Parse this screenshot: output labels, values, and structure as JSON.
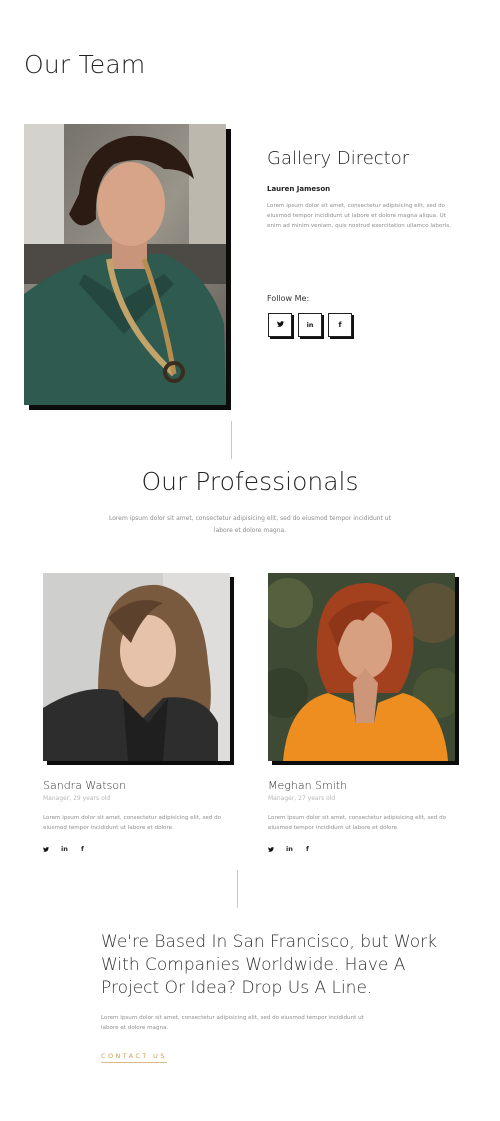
{
  "page": {
    "title": "Our Team"
  },
  "director": {
    "role": "Gallery Director",
    "name": "Lauren Jameson",
    "description": "Lorem ipsum dolor sit amet, consectetur adipisicing elit, sed do eiusmod tempor incididunt ut labore et dolore magna aliqua. Ut enim ad minim veniam, quis nostrud exercitation ullamco laboris.",
    "follow_label": "Follow Me:",
    "social": [
      {
        "icon": "twitter-icon",
        "glyph": "𝕥"
      },
      {
        "icon": "linkedin-icon",
        "glyph": "in"
      },
      {
        "icon": "facebook-icon",
        "glyph": "f"
      }
    ]
  },
  "professionals": {
    "title": "Our Professionals",
    "intro": "Lorem ipsum dolor sit amet, consectetur adipisicing elit, sed do eiusmod tempor incididunt ut labore et dolore magna.",
    "members": [
      {
        "name": "Sandra Watson",
        "subtitle": "Manager, 29 years old",
        "description": "Lorem ipsum dolor sit amet, consectetur adipisicing elit, sed do eiusmod tempor incididunt ut labore et dolore."
      },
      {
        "name": "Meghan Smith",
        "subtitle": "Manager, 27 years old",
        "description": "Lorem ipsum dolor sit amet, consectetur adipisicing elit, sed do eiusmod tempor incididunt ut labore et dolore."
      }
    ],
    "social_glyphs": {
      "twitter": "🐦",
      "linkedin": "in",
      "facebook": "f"
    }
  },
  "cta": {
    "title": "We're Based In San Francisco, but Work With Companies Worldwide. Have A Project Or Idea? Drop Us A Line.",
    "text": "Lorem ipsum dolor sit amet, consectetur adipisicing elit, sed do eiusmod tempor incididunt ut labore et dolore magna.",
    "link_label": "CONTACT US"
  },
  "colors": {
    "accent": "#c9a05b",
    "shadow": "#0c0c0c",
    "text_muted": "#8d8d8d"
  }
}
